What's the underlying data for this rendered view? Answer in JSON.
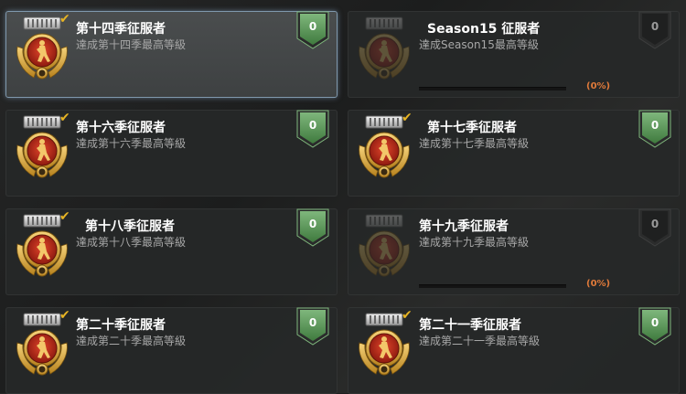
{
  "colors": {
    "gold": "#e7b424",
    "badge_green": "#5e9a5b",
    "badge_gray": "#3a3b3b",
    "progress_text": "#e07a3a",
    "selected_border": "#7f98ad"
  },
  "achievements": [
    {
      "title": "第十四季征服者",
      "desc": "達成第十四季最高等級",
      "count": "0",
      "completed": true,
      "selected": true,
      "rank_icon": "medal-14-icon"
    },
    {
      "title": "Season15 征服者",
      "desc": "達成Season15最高等級",
      "count": "0",
      "completed": false,
      "progress": 0,
      "progress_label": "(0%)",
      "rank_icon": "medal-15-icon"
    },
    {
      "title": "第十六季征服者",
      "desc": "達成第十六季最高等級",
      "count": "0",
      "completed": true,
      "rank_icon": "medal-16-icon"
    },
    {
      "title": "第十七季征服者",
      "desc": "達成第十七季最高等級",
      "count": "0",
      "completed": true,
      "rank_icon": "medal-17-icon"
    },
    {
      "title": "第十八季征服者",
      "desc": "達成第十八季最高等級",
      "count": "0",
      "completed": true,
      "rank_icon": "medal-18-icon"
    },
    {
      "title": "第十九季征服者",
      "desc": "達成第十九季最高等級",
      "count": "0",
      "completed": false,
      "progress": 0,
      "progress_label": "(0%)",
      "rank_icon": "medal-19-icon"
    },
    {
      "title": "第二十季征服者",
      "desc": "達成第二十季最高等級",
      "count": "0",
      "completed": true,
      "rank_icon": "medal-20-icon"
    },
    {
      "title": "第二十一季征服者",
      "desc": "達成第二十一季最高等級",
      "count": "0",
      "completed": true,
      "rank_icon": "medal-21-icon"
    }
  ]
}
